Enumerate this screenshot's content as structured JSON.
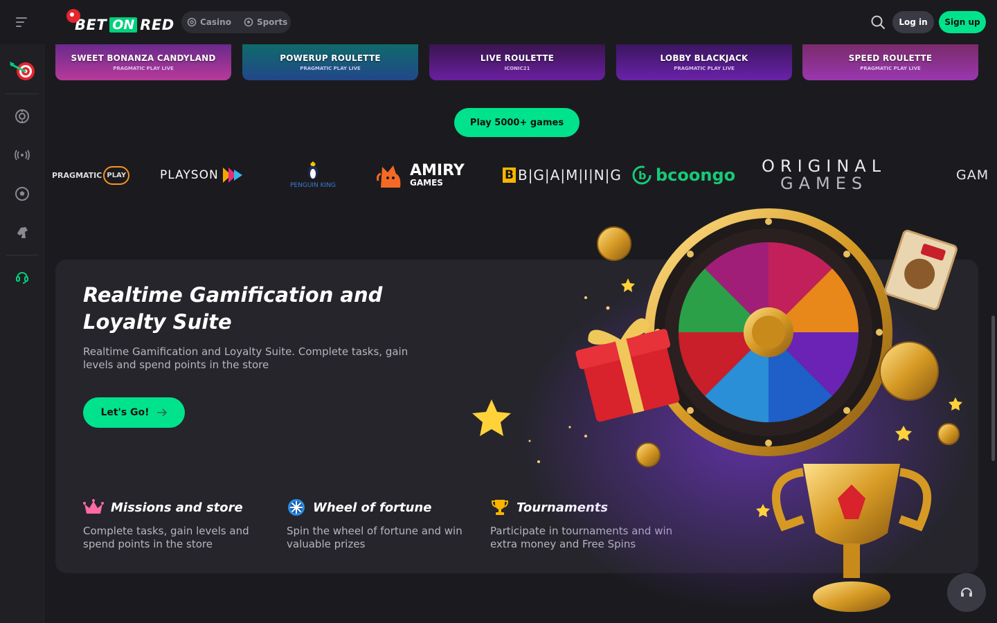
{
  "header": {
    "logo": {
      "part1": "BET",
      "part2": "ON",
      "part3": "RED"
    },
    "modes": [
      {
        "label": "Casino",
        "icon": "casino-chip-icon"
      },
      {
        "label": "Sports",
        "icon": "soccer-ball-icon"
      }
    ],
    "login_label": "Log in",
    "signup_label": "Sign up"
  },
  "sidebar": {
    "items": [
      "darts-icon",
      "casino-chip-icon",
      "live-broadcast-icon",
      "soccer-ball-icon",
      "horse-head-icon",
      "support-headset-icon"
    ]
  },
  "games": [
    {
      "title": "SWEET BONANZA CANDYLAND",
      "provider": "PRAGMATIC PLAY LIVE",
      "color": "#b73a9a"
    },
    {
      "title": "POWERUP ROULETTE",
      "provider": "PRAGMATIC PLAY LIVE",
      "color": "#22478a"
    },
    {
      "title": "LIVE ROULETTE",
      "provider": "ICONIC21",
      "color": "#5b1a8a"
    },
    {
      "title": "LOBBY BLACKJACK",
      "provider": "PRAGMATIC PLAY LIVE",
      "color": "#5c1c8c"
    },
    {
      "title": "SPEED ROULETTE",
      "provider": "PRAGMATIC PLAY LIVE",
      "color": "#8a2fa0"
    }
  ],
  "play_all_label": "Play 5000+ games",
  "providers": [
    {
      "name": "PRAGMATIC",
      "suffix": "PLAY"
    },
    {
      "name": "PLAYSON"
    },
    {
      "name": "PENGUIN KING"
    },
    {
      "name": "AMIRY",
      "sub": "GAMES"
    },
    {
      "name": "BGAMING",
      "display": "B|G|A|M|I|N|G"
    },
    {
      "name": "bcoongo"
    },
    {
      "name": "ORIGINAL",
      "sub": "GAMES"
    },
    {
      "name": "GAM"
    }
  ],
  "loyalty": {
    "title": "Realtime Gamification and Loyalty Suite",
    "description": "Realtime Gamification and Loyalty Suite. Complete tasks, gain levels and spend points in the store",
    "cta_label": "Let's Go!",
    "features": [
      {
        "title": "Missions and store",
        "text": "Complete tasks, gain levels and spend points in the store",
        "icon": "crown-icon"
      },
      {
        "title": "Wheel of fortune",
        "text": "Spin the wheel of fortune and win valuable prizes",
        "icon": "wheel-icon"
      },
      {
        "title": "Tournaments",
        "text": "Participate in tournaments and win extra money and Free Spins",
        "icon": "trophy-icon"
      }
    ]
  },
  "colors": {
    "accent": "#00e38c",
    "background": "#1b1b1f",
    "panel": "#25252b"
  }
}
